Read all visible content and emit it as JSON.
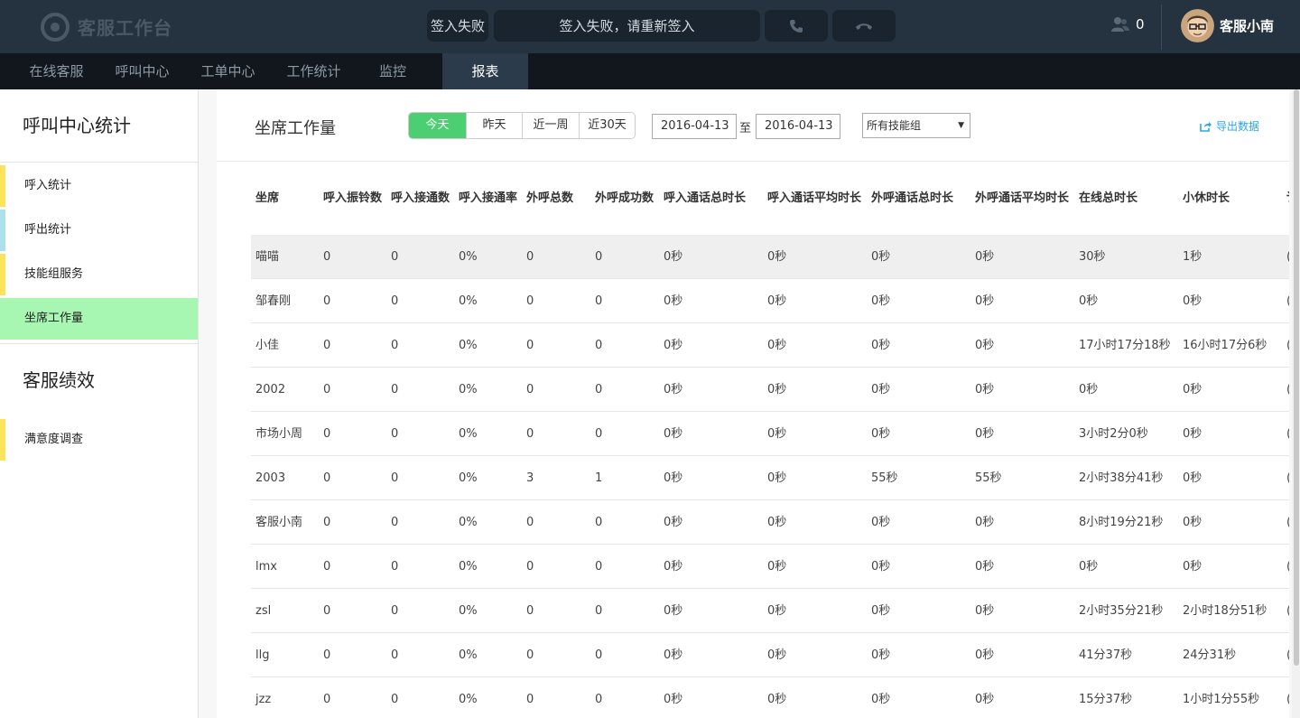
{
  "app": {
    "logo_text": "客服工作台",
    "status_label": "签入失败",
    "status_message": "签入失败，请重新签入",
    "online_count": "0",
    "user_name": "客服小南"
  },
  "nav": {
    "items": [
      {
        "label": "在线客服"
      },
      {
        "label": "呼叫中心"
      },
      {
        "label": "工单中心"
      },
      {
        "label": "工作统计"
      },
      {
        "label": "监控"
      },
      {
        "label": "报表"
      }
    ],
    "active_index": 5
  },
  "sidebar": {
    "section1_title": "呼叫中心统计",
    "section1_items": [
      {
        "label": "呼入统计",
        "bar_color": "#fde25b"
      },
      {
        "label": "呼出统计",
        "bar_color": "#aee0eb"
      },
      {
        "label": "技能组服务",
        "bar_color": "#fde25b"
      },
      {
        "label": "坐席工作量",
        "bar_color": "#a7f7b3"
      }
    ],
    "active_index": 3,
    "section2_title": "客服绩效",
    "section2_items": [
      {
        "label": "满意度调查",
        "bar_color": "#fde25b"
      }
    ]
  },
  "main": {
    "title": "坐席工作量",
    "range_buttons": [
      {
        "label": "今天"
      },
      {
        "label": "昨天"
      },
      {
        "label": "近一周"
      },
      {
        "label": "近30天"
      }
    ],
    "range_active": 0,
    "date_from": "2016-04-13",
    "date_separator": "至",
    "date_to": "2016-04-13",
    "skill_group": "所有技能组",
    "export_label": "导出数据"
  },
  "table": {
    "columns": [
      "坐席",
      "呼入振铃数",
      "呼入接通数",
      "呼入接通率",
      "外呼总数",
      "外呼成功数",
      "呼入通话总时长",
      "呼入通话平均时长",
      "外呼通话总时长",
      "外呼通话平均时长",
      "在线总时长",
      "小休时长",
      "讠"
    ],
    "rows": [
      [
        "喵喵",
        "0",
        "0",
        "0%",
        "0",
        "0",
        "0秒",
        "0秒",
        "0秒",
        "0秒",
        "30秒",
        "1秒",
        "("
      ],
      [
        "邹春刚",
        "0",
        "0",
        "0%",
        "0",
        "0",
        "0秒",
        "0秒",
        "0秒",
        "0秒",
        "0秒",
        "0秒",
        "("
      ],
      [
        "小佳",
        "0",
        "0",
        "0%",
        "0",
        "0",
        "0秒",
        "0秒",
        "0秒",
        "0秒",
        "17小时17分18秒",
        "16小时17分6秒",
        "("
      ],
      [
        "2002",
        "0",
        "0",
        "0%",
        "0",
        "0",
        "0秒",
        "0秒",
        "0秒",
        "0秒",
        "0秒",
        "0秒",
        "("
      ],
      [
        "市场小周",
        "0",
        "0",
        "0%",
        "0",
        "0",
        "0秒",
        "0秒",
        "0秒",
        "0秒",
        "3小时2分0秒",
        "0秒",
        "("
      ],
      [
        "2003",
        "0",
        "0",
        "0%",
        "3",
        "1",
        "0秒",
        "0秒",
        "55秒",
        "55秒",
        "2小时38分41秒",
        "0秒",
        "("
      ],
      [
        "客服小南",
        "0",
        "0",
        "0%",
        "0",
        "0",
        "0秒",
        "0秒",
        "0秒",
        "0秒",
        "8小时19分21秒",
        "0秒",
        "("
      ],
      [
        "lmx",
        "0",
        "0",
        "0%",
        "0",
        "0",
        "0秒",
        "0秒",
        "0秒",
        "0秒",
        "0秒",
        "0秒",
        "("
      ],
      [
        "zsl",
        "0",
        "0",
        "0%",
        "0",
        "0",
        "0秒",
        "0秒",
        "0秒",
        "0秒",
        "2小时35分21秒",
        "2小时18分51秒",
        "("
      ],
      [
        "llg",
        "0",
        "0",
        "0%",
        "0",
        "0",
        "0秒",
        "0秒",
        "0秒",
        "0秒",
        "41分37秒",
        "24分31秒",
        "("
      ],
      [
        "jzz",
        "0",
        "0",
        "0%",
        "0",
        "0",
        "0秒",
        "0秒",
        "0秒",
        "0秒",
        "15分37秒",
        "1小时1分55秒",
        "("
      ]
    ],
    "highlight_row": 0
  }
}
